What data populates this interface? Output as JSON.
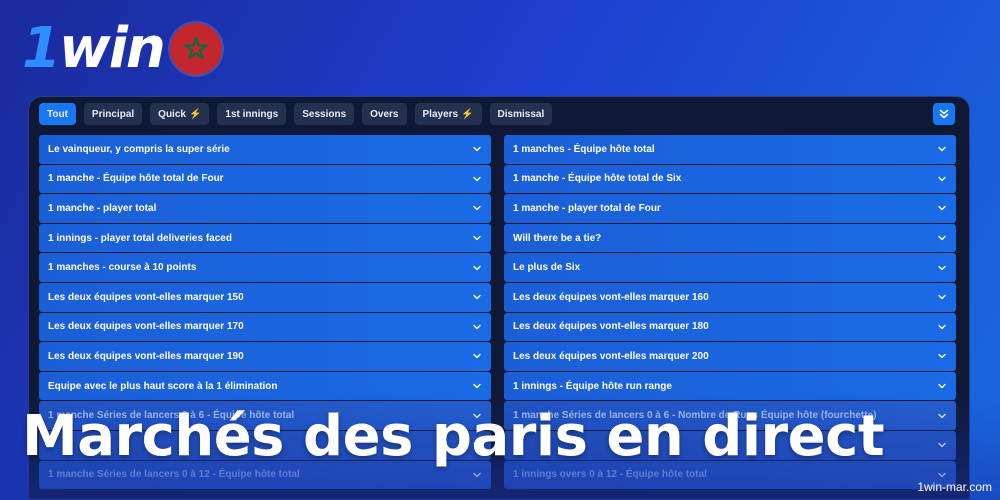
{
  "brand": {
    "logo_one": "1",
    "logo_rest": "win"
  },
  "tabs": [
    {
      "label": "Tout",
      "active": true
    },
    {
      "label": "Principal"
    },
    {
      "label": "Quick",
      "icon": "bolt-icon"
    },
    {
      "label": "1st innings"
    },
    {
      "label": "Sessions"
    },
    {
      "label": "Overs"
    },
    {
      "label": "Players",
      "icon": "bolt-icon"
    },
    {
      "label": "Dismissal"
    }
  ],
  "markets_left": [
    "Le vainqueur, y compris la super série",
    "1 manche - Équipe hôte total de Four",
    "1 manche - player total",
    "1 innings - player total deliveries faced",
    "1 manches - course à 10 points",
    "Les deux équipes vont-elles marquer 150",
    "Les deux équipes vont-elles marquer 170",
    "Les deux équipes vont-elles marquer 190",
    "Equipe avec le plus haut score à la 1 élimination",
    "1 manche Séries de lancers 0 à 6 - Équipe hôte total",
    "",
    "1 manche Séries de lancers 0 à 12 - Équipe hôte total"
  ],
  "markets_right": [
    "1 manches - Équipe hôte total",
    "1 manche - Équipe hôte total de Six",
    "1 manche - player total de Four",
    "Will there be a tie?",
    "Le plus de Six",
    "Les deux équipes vont-elles marquer 160",
    "Les deux équipes vont-elles marquer 180",
    "Les deux équipes vont-elles marquer 200",
    "1 innings - Équipe hôte run range",
    "1 manche Séries de lancers 0 à 6 - Nombre de Runs Équipe hôte (fourchette)",
    "",
    "1 innings overs 0 à 12 - Équipe hôte total"
  ],
  "headline": "Marchés des paris en direct",
  "watermark": "1win-mar.com",
  "colors": {
    "accent": "#1877f2",
    "row": "#1a6be6",
    "panel": "#0f1935",
    "flag": "#c1272d",
    "star": "#0a6b3a"
  }
}
